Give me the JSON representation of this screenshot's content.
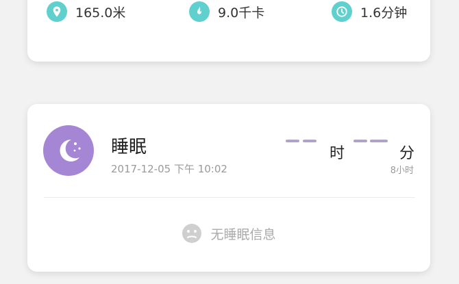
{
  "activity": {
    "distance": "165.0米",
    "calories": "9.0千卡",
    "duration": "1.6分钟"
  },
  "sleep": {
    "title": "睡眠",
    "date": "2017-12-05 下午 10:02",
    "hour_unit": "时",
    "minute_unit": "分",
    "goal": "8小时",
    "empty_message": "无睡眠信息"
  },
  "colors": {
    "teal_icon": "#5fd0cd",
    "moon_avatar": "#a586d4",
    "dash": "#b0a3c9"
  },
  "icons": [
    "location-pin-icon",
    "flame-icon",
    "clock-icon",
    "moon-stars-icon",
    "sad-face-icon"
  ]
}
